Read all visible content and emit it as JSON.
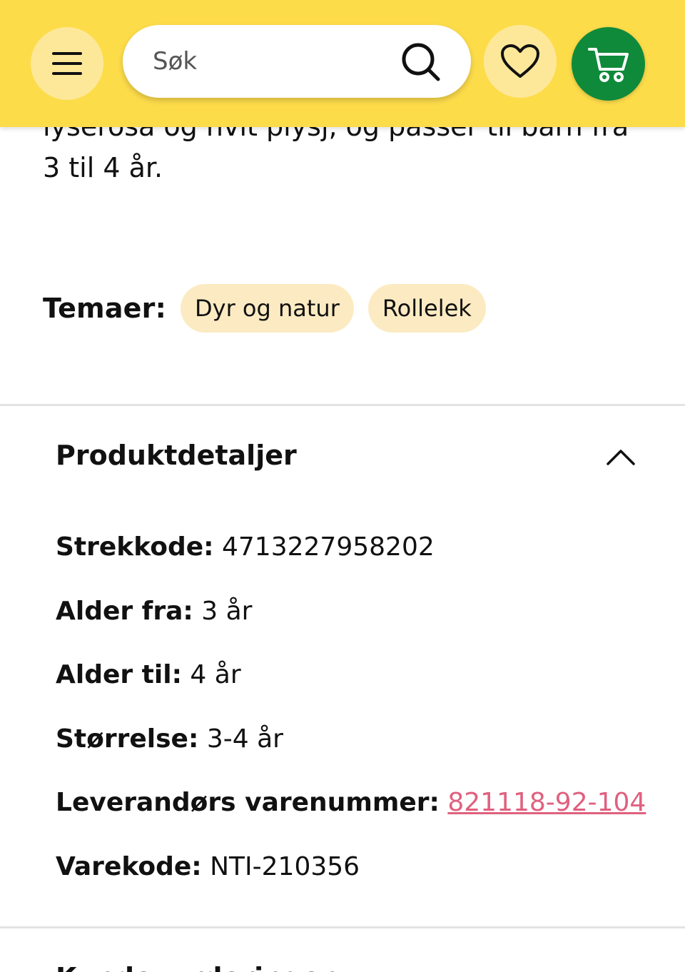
{
  "header": {
    "search_placeholder": "Søk",
    "accent_color": "#fddc4a",
    "cart_color": "#0f8a3a",
    "icons": [
      "menu-icon",
      "search-icon",
      "heart-icon",
      "cart-icon"
    ]
  },
  "description": {
    "line_cut": "lyserosa og hvit plysj, og passer til barn fra",
    "line_end": "3 til 4 år."
  },
  "themes": {
    "label": "Temaer:",
    "chips": [
      "Dyr og natur",
      "Rollelek"
    ]
  },
  "product_details": {
    "title": "Produktdetaljer",
    "rows": [
      {
        "key": "Strekkode:",
        "value": "4713227958202"
      },
      {
        "key": "Alder fra:",
        "value": "3 år"
      },
      {
        "key": "Alder til:",
        "value": "4 år"
      },
      {
        "key": "Størrelse:",
        "value": "3-4 år"
      },
      {
        "key": "Leverandørs varenummer:",
        "value": "821118-92-104"
      },
      {
        "key": "Varekode:",
        "value": "NTI-210356"
      }
    ],
    "link_color": "#e0607e"
  },
  "next_section": {
    "title": "Kundevurderinger"
  }
}
